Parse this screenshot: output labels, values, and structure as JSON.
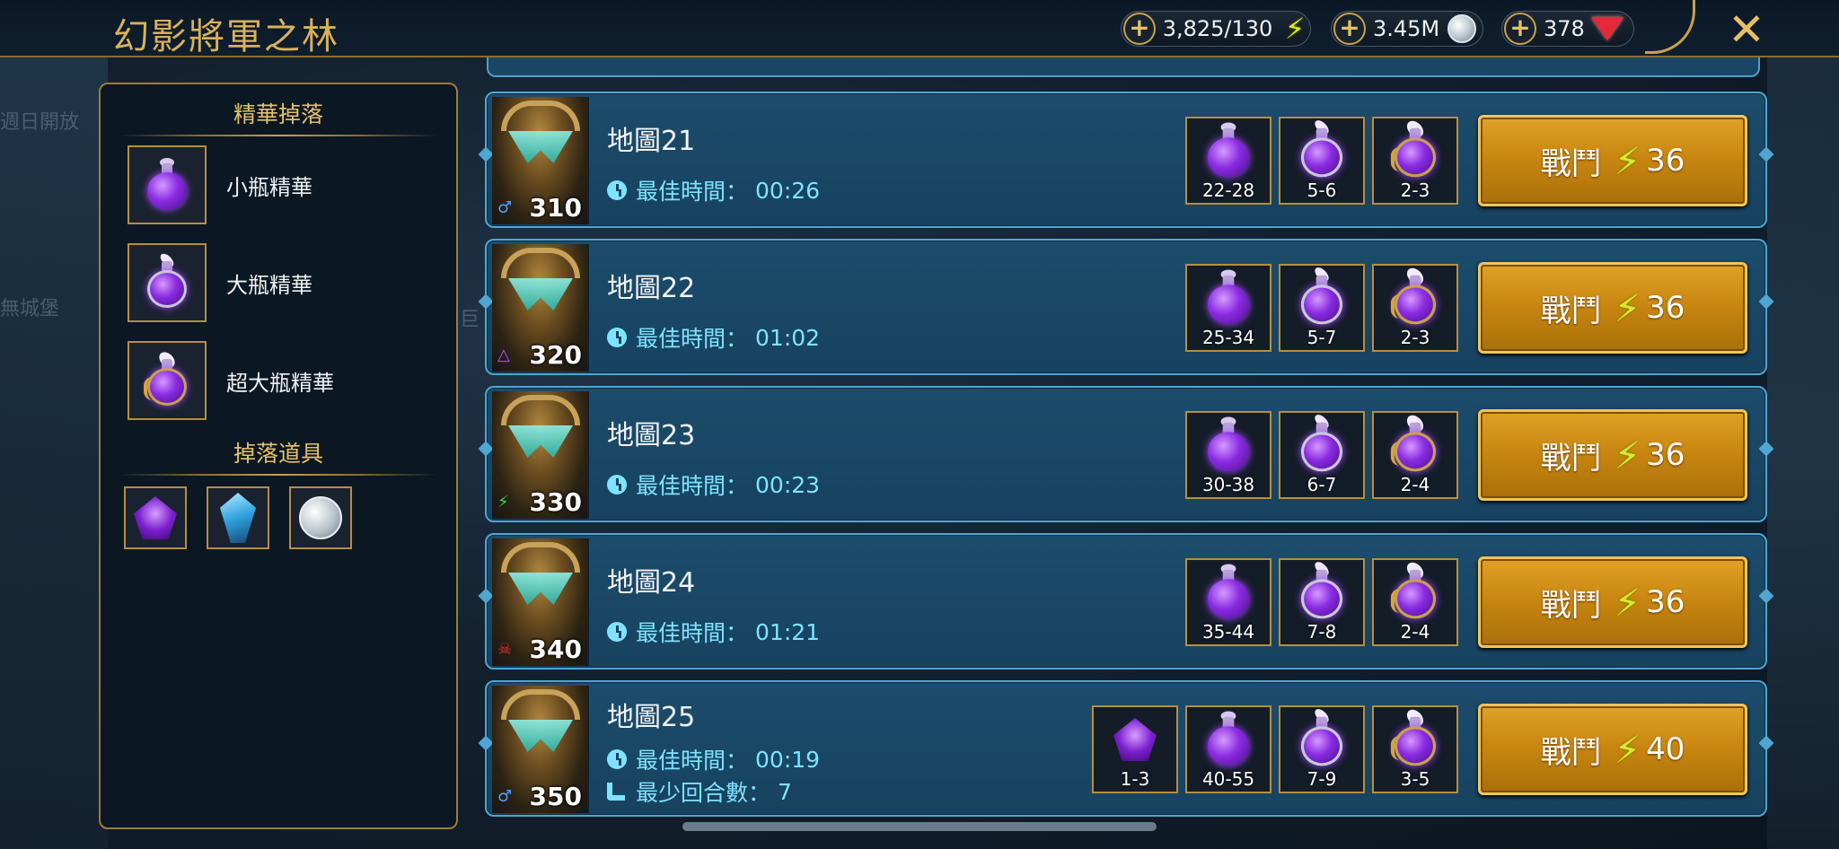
{
  "header": {
    "title": "幻影將軍之林",
    "energy": "3,825/130",
    "silver": "3.45M",
    "gems": "378",
    "plus_label": "+",
    "close_label": "✕"
  },
  "background": {
    "text1": "週日開放",
    "text2": "無城堡",
    "text3": "巨"
  },
  "left_panel": {
    "essence_heading": "精華掉落",
    "essences": [
      {
        "label": "小瓶精華",
        "icon": "small-essence-potion-icon"
      },
      {
        "label": "大瓶精華",
        "icon": "large-essence-potion-icon"
      },
      {
        "label": "超大瓶精華",
        "icon": "superior-essence-potion-icon"
      }
    ],
    "items_heading": "掉落道具",
    "drop_items": [
      {
        "icon": "purple-artifact-icon"
      },
      {
        "icon": "blue-artifact-icon"
      },
      {
        "icon": "silver-coin-icon"
      }
    ]
  },
  "maps": [
    {
      "name": "地圖21",
      "time_label": "最佳時間：",
      "time": "00:26",
      "power": "310",
      "affinity": "magic",
      "affinity_color": "#4aa3ff",
      "drops": [
        "22-28",
        "5-6",
        "2-3"
      ],
      "fight_label": "戰鬥",
      "cost": "36"
    },
    {
      "name": "地圖22",
      "time_label": "最佳時間：",
      "time": "01:02",
      "power": "320",
      "affinity": "force",
      "affinity_color": "#c04fff",
      "drops": [
        "25-34",
        "5-7",
        "2-3"
      ],
      "fight_label": "戰鬥",
      "cost": "36"
    },
    {
      "name": "地圖23",
      "time_label": "最佳時間：",
      "time": "00:23",
      "power": "330",
      "affinity": "spirit",
      "affinity_color": "#3fd44a",
      "drops": [
        "30-38",
        "6-7",
        "2-4"
      ],
      "fight_label": "戰鬥",
      "cost": "36"
    },
    {
      "name": "地圖24",
      "time_label": "最佳時間：",
      "time": "01:21",
      "power": "340",
      "affinity": "void",
      "affinity_color": "#e23030",
      "drops": [
        "35-44",
        "7-8",
        "2-4"
      ],
      "fight_label": "戰鬥",
      "cost": "36"
    },
    {
      "name": "地圖25",
      "time_label": "最佳時間：",
      "time": "00:19",
      "turns_label": "最少回合數：",
      "turns": "7",
      "power": "350",
      "affinity": "magic",
      "affinity_color": "#4aa3ff",
      "artifact_drop": "1-3",
      "drops": [
        "40-55",
        "7-9",
        "3-5"
      ],
      "fight_label": "戰鬥",
      "cost": "40"
    }
  ],
  "colors": {
    "gold": "#c9a14c",
    "row_bg": "#1c4c6c",
    "row_border": "#4fa6d3",
    "button": "#d9961c",
    "time_text": "#7fe3ff"
  }
}
